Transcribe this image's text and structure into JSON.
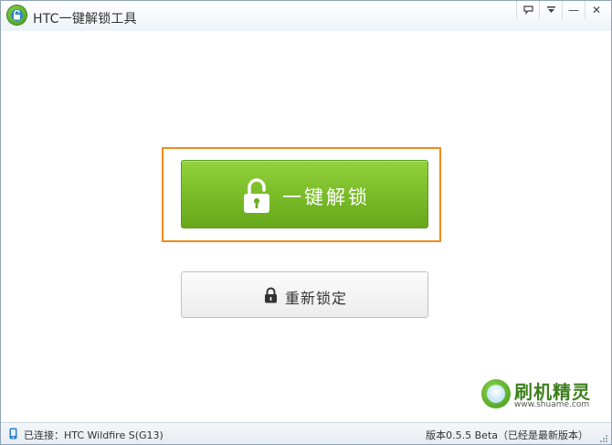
{
  "window": {
    "title": "HTC一键解锁工具",
    "controls": {
      "feedback_icon": "chat-icon",
      "menu_icon": "dropdown-icon",
      "minimize": "—",
      "close": "✕"
    }
  },
  "main": {
    "unlock_button": {
      "label": "一键解锁",
      "icon": "unlock-icon"
    },
    "relock_button": {
      "label": "重新锁定",
      "icon": "lock-icon"
    },
    "highlight_color": "#f28a1c",
    "primary_color": "#7bbd2a"
  },
  "watermark": {
    "name": "刷机精灵",
    "url": "www.shuame.com"
  },
  "status": {
    "connection": "已连接：HTC Wildfire S(G13)",
    "version": "版本0.5.5 Beta（已经是最新版本）"
  }
}
